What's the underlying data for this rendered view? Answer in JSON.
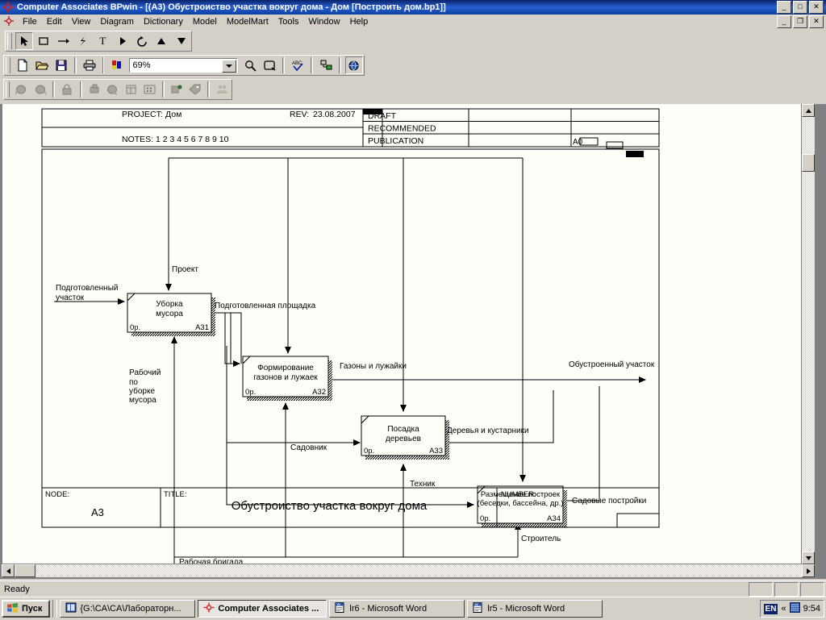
{
  "window": {
    "title": "Computer Associates BPwin - [(A3) Обустроиство  участка  вокруг дома - Дом  [Построить дом.bp1]]",
    "minimize_label": "_",
    "maximize_label": "□",
    "close_label": "✕",
    "app_icon": "bpwin-target-icon"
  },
  "menubar": {
    "items": [
      {
        "label": "File"
      },
      {
        "label": "Edit"
      },
      {
        "label": "View"
      },
      {
        "label": "Diagram"
      },
      {
        "label": "Dictionary"
      },
      {
        "label": "Model"
      },
      {
        "label": "ModelMart"
      },
      {
        "label": "Tools"
      },
      {
        "label": "Window"
      },
      {
        "label": "Help"
      }
    ],
    "child_minimize_label": "_",
    "child_restore_label": "❐",
    "child_close_label": "✕"
  },
  "toolbars": {
    "draw": [
      {
        "name": "pointer-tool",
        "glyph": "↖",
        "selected": true
      },
      {
        "name": "activity-box-tool",
        "glyph": "□",
        "selected": false
      },
      {
        "name": "arrow-tool",
        "glyph": "→",
        "selected": false
      },
      {
        "name": "squiggle-tool",
        "glyph": "⚡",
        "selected": false
      },
      {
        "name": "text-tool",
        "glyph": "T",
        "selected": false
      },
      {
        "name": "tunnel-tool",
        "glyph": "▶",
        "selected": false
      },
      {
        "name": "rotate-tool",
        "glyph": "↺",
        "selected": false
      },
      {
        "name": "up-arrow-tool",
        "glyph": "▲",
        "selected": false
      },
      {
        "name": "down-arrow-tool",
        "glyph": "▼",
        "selected": false
      }
    ],
    "standard": [
      {
        "name": "new-icon"
      },
      {
        "name": "open-icon"
      },
      {
        "name": "save-icon"
      },
      {
        "name": "print-icon"
      },
      {
        "name": "color-palette-icon"
      }
    ],
    "standard_right": [
      {
        "name": "zoom-icon"
      },
      {
        "name": "fit-to-window-icon"
      },
      {
        "name": "spell-check-icon"
      },
      {
        "name": "model-explorer-icon"
      },
      {
        "name": "odbc-icon"
      }
    ],
    "zoom": {
      "value": "69%",
      "placeholder": "Zoom"
    },
    "modelmart": [
      {
        "name": "check-out-icon"
      },
      {
        "name": "check-in-icon"
      },
      {
        "name": "lock-icon"
      },
      {
        "name": "merge-icon"
      },
      {
        "name": "refresh-icon"
      },
      {
        "name": "store-icon"
      },
      {
        "name": "grid-icon"
      },
      {
        "name": "change-owner-icon"
      },
      {
        "name": "tag-icon"
      },
      {
        "name": "users-icon"
      }
    ]
  },
  "diagram": {
    "header": {
      "project_label": "PROJECT:",
      "project_value": "Дом",
      "rev_label": "REV:",
      "rev_value": "23.08.2007",
      "notes_label": "NOTES:",
      "notes_numbers": "1  2   3   4   5   6   7   8   9  10",
      "status_rows": [
        "DRAFT",
        "RECOMMENDED",
        "PUBLICATION"
      ],
      "page_code": "A0"
    },
    "boxes": [
      {
        "name": "Уборка\nмусора",
        "cost": "0р.",
        "id": "A31"
      },
      {
        "name": "Формирование\nгазонов  и лужаек",
        "cost": "0р.",
        "id": "A32"
      },
      {
        "name": "Посадка\nдеревьев",
        "cost": "0р.",
        "id": "A33"
      },
      {
        "name": "Размещение построек\n(беседки, бассейна, др.)",
        "cost": "0р.",
        "id": "A34"
      }
    ],
    "arrow_labels": [
      {
        "text": "Подготовленный\nучасток"
      },
      {
        "text": "Проект"
      },
      {
        "text": "Подготовленная площадка"
      },
      {
        "text": "Рабочий\nпо\nуборке\nмусора"
      },
      {
        "text": "Газоны и лужайки"
      },
      {
        "text": "Садовник"
      },
      {
        "text": "Деревья и кустарники"
      },
      {
        "text": "Техник"
      },
      {
        "text": "Обустроенный  участок"
      },
      {
        "text": "Садовые постройки"
      },
      {
        "text": "Строитель"
      },
      {
        "text": "Рабочая бригада"
      },
      {
        "text": "[ ]"
      }
    ],
    "footer": {
      "node_label": "NODE:",
      "node_value": "A3",
      "title_label": "TITLE:",
      "title_value": "Обустроиство  участка  вокруг дома",
      "number_label": "NUMBER:",
      "number_value": ""
    }
  },
  "statusbar": {
    "text": "Ready"
  },
  "taskbar": {
    "start_label": "Пуск",
    "items": [
      {
        "label": "{G:\\CA\\CA\\Лабораторн...",
        "icon": "explorer-icon",
        "active": false
      },
      {
        "label": "Computer Associates ...",
        "icon": "bpwin-target-icon",
        "active": true
      },
      {
        "label": "lr6 - Microsoft Word",
        "icon": "word-icon",
        "active": false
      },
      {
        "label": "lr5 - Microsoft Word",
        "icon": "word-icon",
        "active": false
      }
    ],
    "tray": {
      "language": "EN",
      "chevron": "«",
      "calendar_icon": "calendar-icon",
      "clock": "9:54"
    }
  },
  "colors": {
    "titlebar_start": "#0a246a",
    "titlebar_end": "#2a5fd0",
    "face": "#d4d0c8",
    "canvas": "#fffdf7",
    "accent": "#0a246a"
  }
}
